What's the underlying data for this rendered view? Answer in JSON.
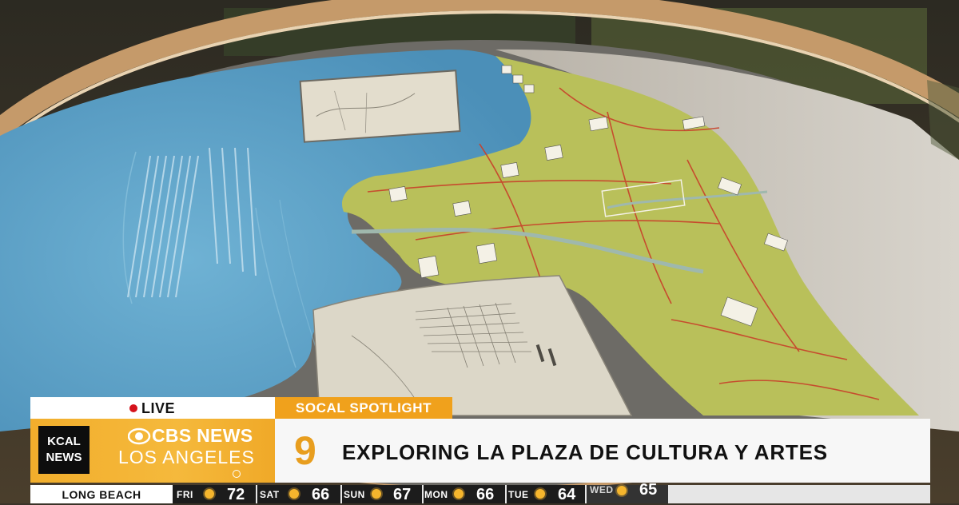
{
  "image_alt": "Raised-relief map of the Los Angeles region displayed on a round exhibit table",
  "lower_third": {
    "live_label": "LIVE",
    "segment_label": "SOCAL SPOTLIGHT",
    "station_logo_line1": "KCAL",
    "station_logo_line2": "NEWS",
    "brand_line1": "CBS NEWS",
    "brand_line2": "LOS ANGELES",
    "channel_number": "9",
    "headline": "EXPLORING LA PLAZA DE CULTURA Y ARTES"
  },
  "ticker": {
    "city": "LONG BEACH",
    "forecast": [
      {
        "day": "FRI",
        "temp": "72",
        "icon": "sun-icon"
      },
      {
        "day": "SAT",
        "temp": "66",
        "icon": "sun-icon"
      },
      {
        "day": "SUN",
        "temp": "67",
        "icon": "sun-icon"
      },
      {
        "day": "MON",
        "temp": "66",
        "icon": "sun-icon"
      },
      {
        "day": "TUE",
        "temp": "64",
        "icon": "sun-icon"
      },
      {
        "day": "WED",
        "temp": "65",
        "icon": "sun-icon"
      }
    ]
  },
  "colors": {
    "accent_orange": "#f0a11c",
    "live_red": "#d5121b",
    "ocean_blue": "#5aa3c8",
    "map_green": "#b9c05a"
  }
}
